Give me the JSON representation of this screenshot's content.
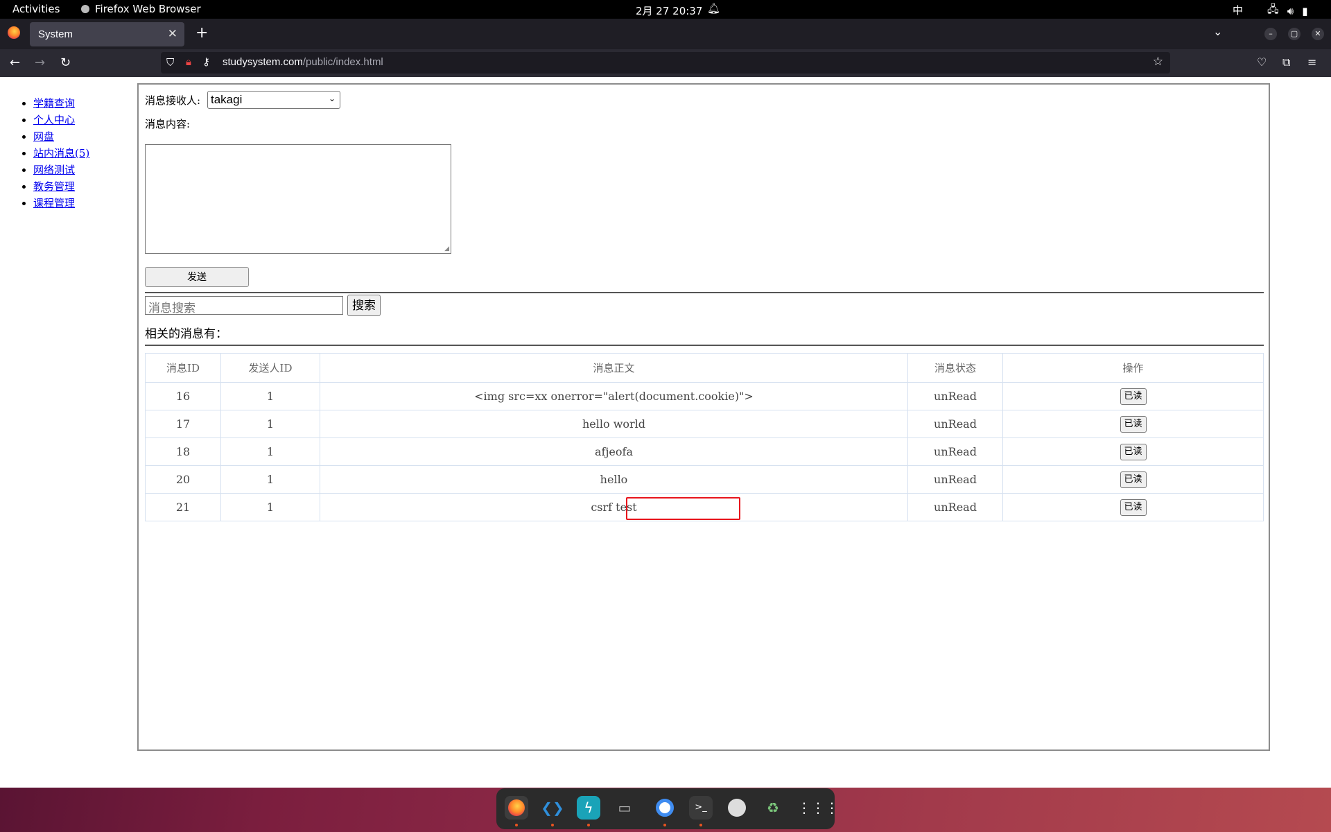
{
  "topbar": {
    "activities": "Activities",
    "app_name": "Firefox Web Browser",
    "clock": "2月 27  20:37",
    "ime": "中"
  },
  "browser": {
    "tab_title": "System",
    "url_host": "studysystem.com",
    "url_path": "/public/index.html"
  },
  "sidebar": {
    "items": [
      {
        "label": "学籍查询"
      },
      {
        "label": "个人中心"
      },
      {
        "label": "网盘"
      },
      {
        "label": "站内消息(5)"
      },
      {
        "label": "网络测试"
      },
      {
        "label": "教务管理"
      },
      {
        "label": "课程管理"
      }
    ]
  },
  "form": {
    "recipient_label": "消息接收人:",
    "recipient_value": "takagi",
    "content_label": "消息内容:",
    "send_label": "发送",
    "search_placeholder": "消息搜索",
    "search_button": "搜索",
    "related_label": "相关的消息有："
  },
  "table": {
    "headers": [
      "消息ID",
      "发送人ID",
      "消息正文",
      "消息状态",
      "操作"
    ],
    "rows": [
      {
        "id": "16",
        "sender": "1",
        "body": "<img src=xx onerror=\"alert(document.cookie)\">",
        "status": "unRead",
        "action": "已读"
      },
      {
        "id": "17",
        "sender": "1",
        "body": "hello world",
        "status": "unRead",
        "action": "已读"
      },
      {
        "id": "18",
        "sender": "1",
        "body": "afjeofa",
        "status": "unRead",
        "action": "已读"
      },
      {
        "id": "20",
        "sender": "1",
        "body": "hello",
        "status": "unRead",
        "action": "已读"
      },
      {
        "id": "21",
        "sender": "1",
        "body": "csrf test",
        "status": "unRead",
        "action": "已读"
      }
    ],
    "highlighted_row": "21"
  },
  "dock": {
    "apps": [
      "firefox-icon",
      "vscode-icon",
      "sublime-icon",
      "files-icon",
      "chrome-icon",
      "terminal-icon",
      "disc-icon",
      "trash-icon",
      "app-grid-icon"
    ]
  },
  "colors": {
    "highlight": "#e8141c",
    "link": "#0000ee"
  }
}
